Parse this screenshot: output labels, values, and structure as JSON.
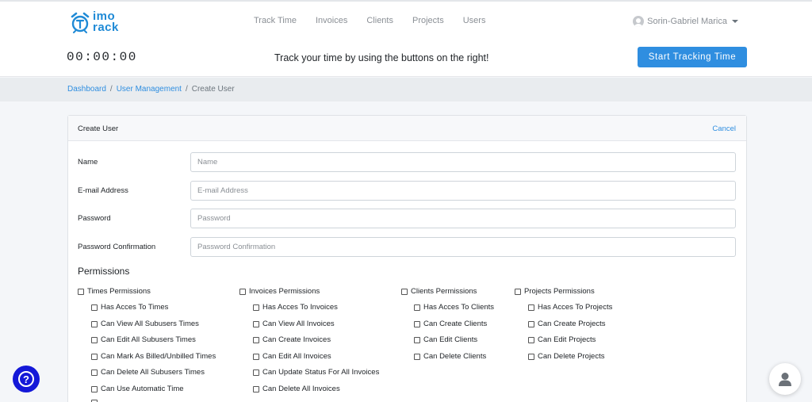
{
  "brand": {
    "line1": "imo",
    "line2": "rack"
  },
  "nav": {
    "items": [
      {
        "label": "Track Time"
      },
      {
        "label": "Invoices"
      },
      {
        "label": "Clients"
      },
      {
        "label": "Projects"
      },
      {
        "label": "Users"
      }
    ],
    "user_name": "Sorin-Gabriel Marica"
  },
  "timer": {
    "value": "00:00:00",
    "hint": "Track your time by using the buttons on the right!",
    "start_label": "Start Tracking Time"
  },
  "breadcrumb": {
    "dashboard": "Dashboard",
    "separator": "/",
    "user_management": "User Management",
    "current": "Create User"
  },
  "card": {
    "title": "Create User",
    "cancel": "Cancel",
    "fields": {
      "name": {
        "label": "Name",
        "placeholder": "Name"
      },
      "email": {
        "label": "E-mail Address",
        "placeholder": "E-mail Address"
      },
      "password": {
        "label": "Password",
        "placeholder": "Password"
      },
      "password_confirmation": {
        "label": "Password Confirmation",
        "placeholder": "Password Confirmation"
      }
    },
    "permissions_title": "Permissions",
    "permissions": {
      "times": {
        "group": "Times Permissions",
        "items": [
          "Has Acces To Times",
          "Can View All Subusers Times",
          "Can Edit All Subusers Times",
          "Can Mark As Billed/Unbilled Times",
          "Can Delete All Subusers Times",
          "Can Use Automatic Time"
        ]
      },
      "invoices": {
        "group": "Invoices Permissions",
        "items": [
          "Has Acces To Invoices",
          "Can View All Invoices",
          "Can Create Invoices",
          "Can Edit All Invoices",
          "Can Update Status For All Invoices",
          "Can Delete All Invoices"
        ]
      },
      "clients": {
        "group": "Clients Permissions",
        "items": [
          "Has Acces To Clients",
          "Can Create Clients",
          "Can Edit Clients",
          "Can Delete Clients"
        ]
      },
      "projects": {
        "group": "Projects Permissions",
        "items": [
          "Has Acces To Projects",
          "Can Create Projects",
          "Can Edit Projects",
          "Can Delete Projects"
        ]
      }
    }
  },
  "colors": {
    "accent": "#2f8ee0",
    "help": "#1418d8"
  },
  "icons": {
    "logo": "alarm-clock-icon",
    "avatar": "user-avatar-icon",
    "help": "question-mark-icon",
    "support": "person-icon"
  }
}
